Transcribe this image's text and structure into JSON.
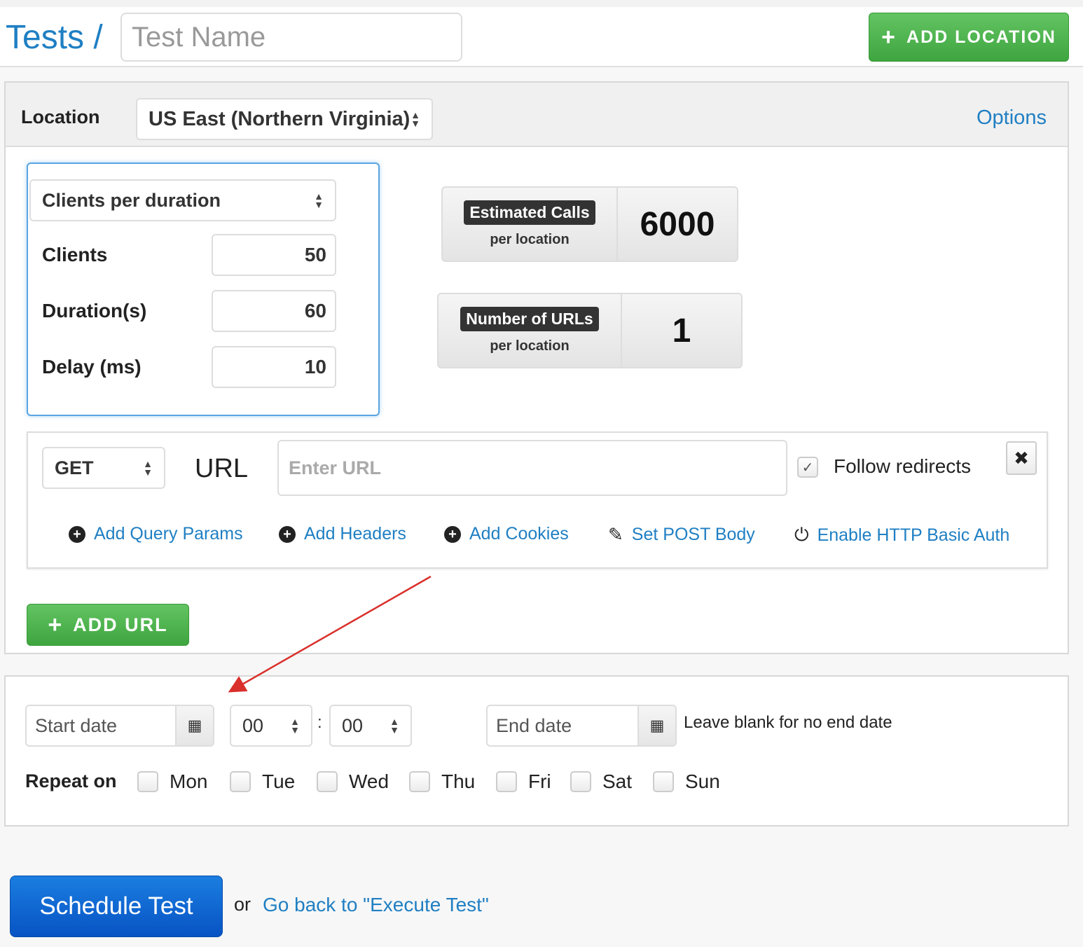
{
  "header": {
    "breadcrumb": "Tests /",
    "test_name_placeholder": "Test Name",
    "add_location_label": "ADD LOCATION"
  },
  "location": {
    "label": "Location",
    "selected": "US East (Northern Virginia)",
    "options_link": "Options"
  },
  "load": {
    "mode": "Clients per duration",
    "clients_label": "Clients",
    "clients_value": "50",
    "duration_label": "Duration(s)",
    "duration_value": "60",
    "delay_label": "Delay (ms)",
    "delay_value": "10"
  },
  "stats": {
    "estimated_calls_title": "Estimated Calls",
    "estimated_calls_sub": "per location",
    "estimated_calls_value": "6000",
    "num_urls_title": "Number of URLs",
    "num_urls_sub": "per location",
    "num_urls_value": "1"
  },
  "request": {
    "method": "GET",
    "url_label": "URL",
    "url_placeholder": "Enter URL",
    "follow_redirects_label": "Follow redirects",
    "follow_redirects_checked": true,
    "actions": {
      "query_params": "Add Query Params",
      "headers": "Add Headers",
      "cookies": "Add Cookies",
      "post_body": "Set POST Body",
      "basic_auth": "Enable HTTP Basic Auth"
    },
    "add_url_label": "ADD URL"
  },
  "schedule": {
    "start_date_placeholder": "Start date",
    "hour": "00",
    "minute": "00",
    "end_date_placeholder": "End date",
    "end_hint": "Leave blank for no end date",
    "repeat_label": "Repeat on",
    "days": [
      "Mon",
      "Tue",
      "Wed",
      "Thu",
      "Fri",
      "Sat",
      "Sun"
    ]
  },
  "footer": {
    "schedule_button": "Schedule Test",
    "or_text": "or",
    "back_link": "Go back to \"Execute Test\""
  },
  "colors": {
    "link": "#1f7fc3",
    "green_button": "#4cb84c",
    "primary_button": "#0f67d2",
    "annotation_arrow": "#d9302c"
  }
}
